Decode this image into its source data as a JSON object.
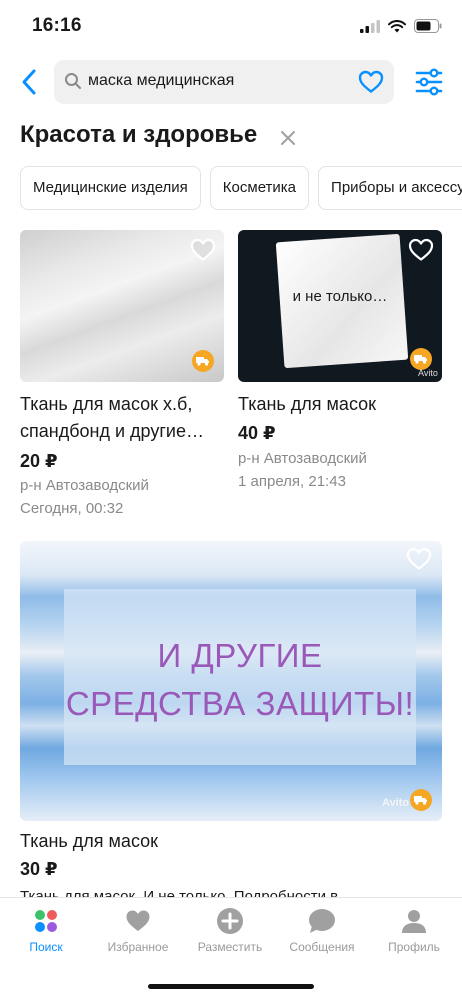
{
  "status_bar": {
    "time": "16:16"
  },
  "search": {
    "query": "маска медицинская"
  },
  "category": {
    "title": "Красота и здоровье"
  },
  "chips": [
    "Медицинские изделия",
    "Косметика",
    "Приборы и аксессуары"
  ],
  "listings": [
    {
      "title": "Ткань для масок х.б, спандбонд и другие…",
      "price": "20 ₽",
      "location": "р-н Автозаводский",
      "date": "Сегодня, 00:32"
    },
    {
      "title": "Ткань для масок",
      "price": "40 ₽",
      "location": "р-н Автозаводский",
      "date": "1 апреля, 21:43",
      "image_text": "и не только…",
      "watermark": "Avito"
    },
    {
      "title": "Ткань для масок",
      "price": "30 ₽",
      "description": "Ткань для масок. И не только. Подробности в",
      "image_text_line1": "И ДРУГИЕ",
      "image_text_line2": "СРЕДСТВА ЗАЩИТЫ!",
      "watermark": "Avito"
    }
  ],
  "tabbar": {
    "items": [
      {
        "label": "Поиск",
        "icon": "search-tab-icon",
        "active": true
      },
      {
        "label": "Избранное",
        "icon": "heart-icon"
      },
      {
        "label": "Разместить",
        "icon": "plus-circle-icon"
      },
      {
        "label": "Сообщения",
        "icon": "chat-bubble-icon"
      },
      {
        "label": "Профиль",
        "icon": "person-icon"
      }
    ]
  },
  "colors": {
    "accent": "#0a8fff",
    "delivery_badge": "#f5a623",
    "meta_text": "#8a8a8a"
  }
}
